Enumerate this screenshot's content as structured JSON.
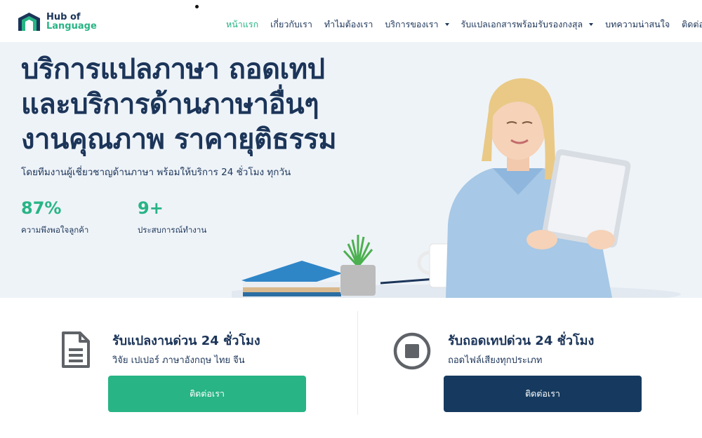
{
  "header": {
    "logo_line1": "Hub of",
    "logo_line2": "Language",
    "nav": [
      {
        "label": "หน้าแรก",
        "active": true
      },
      {
        "label": "เกี่ยวกับเรา"
      },
      {
        "label": "ทำไมต้องเรา"
      },
      {
        "label": "บริการของเรา",
        "dropdown": true
      },
      {
        "label": "รับแปลเอกสารพร้อมรับรองกงสุล",
        "dropdown": true
      },
      {
        "label": "บทความน่าสนใจ"
      },
      {
        "label": "ติดต่อเรา"
      }
    ]
  },
  "hero": {
    "title_lines": [
      "บริการแปลภาษา ถอดเทป",
      "และบริการด้านภาษาอื่นๆ",
      "งานคุณภาพ ราคายุติธรรม"
    ],
    "subtitle": "โดยทีมงานผู้เชี่ยวชาญด้านภาษา พร้อมให้บริการ 24 ชั่วโมง ทุกวัน",
    "stats": [
      {
        "value": "87%",
        "label": "ความพึงพอใจลูกค้า"
      },
      {
        "value": "9+",
        "label": "ประสบการณ์ทำงาน"
      }
    ]
  },
  "cards": [
    {
      "icon": "document-icon",
      "title": "รับแปลงานด่วน 24 ชั่วโมง",
      "subtitle": "วิจัย เปเปอร์ ภาษาอังกฤษ ไทย จีน",
      "button": "ติดต่อเรา"
    },
    {
      "icon": "stop-circle-icon",
      "title": "รับถอดเทปด่วน 24 ชั่วโมง",
      "subtitle": "ถอดไฟล์เสียงทุกประเภท",
      "button": "ติดต่อเรา"
    }
  ],
  "colors": {
    "brand_navy": "#1c3559",
    "brand_green": "#28b485",
    "button_navy": "#163a5f",
    "hero_bg": "#eef3f8"
  }
}
